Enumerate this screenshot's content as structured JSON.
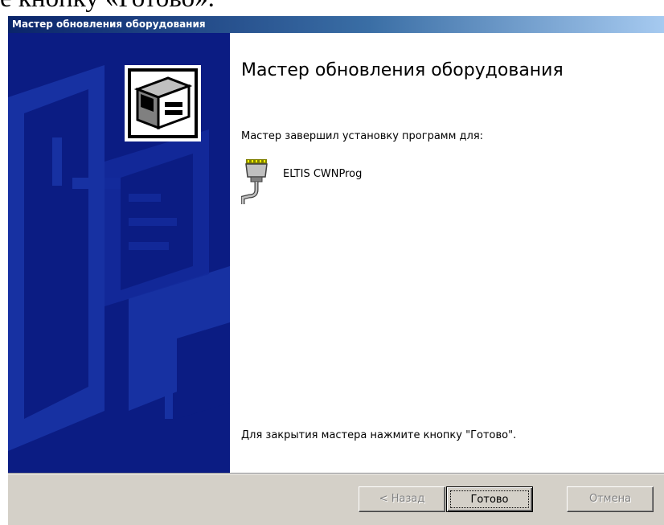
{
  "page_text": {
    "doc_fragment": "е кнопку «Готово»."
  },
  "window": {
    "title": "Мастер обновления оборудования"
  },
  "content": {
    "heading": "Мастер обновления оборудования",
    "subtitle": "Мастер завершил установку программ для:",
    "device_name": "ELTIS CWNProg",
    "close_hint": "Для закрытия мастера нажмите кнопку \"Готово\"."
  },
  "buttons": {
    "back_label": "< Назад",
    "finish_label": "Готово",
    "cancel_label": "Отмена",
    "back_enabled": false,
    "cancel_enabled": false
  },
  "icons": {
    "wizard": "hardware-wizard-icon",
    "device": "serial-port-icon"
  },
  "colors": {
    "sidebar_bg": "#0b1c83",
    "titlebar_start": "#0a246a",
    "titlebar_end": "#a6caf0",
    "button_face": "#d4d0c8",
    "disabled_text": "#808080"
  }
}
